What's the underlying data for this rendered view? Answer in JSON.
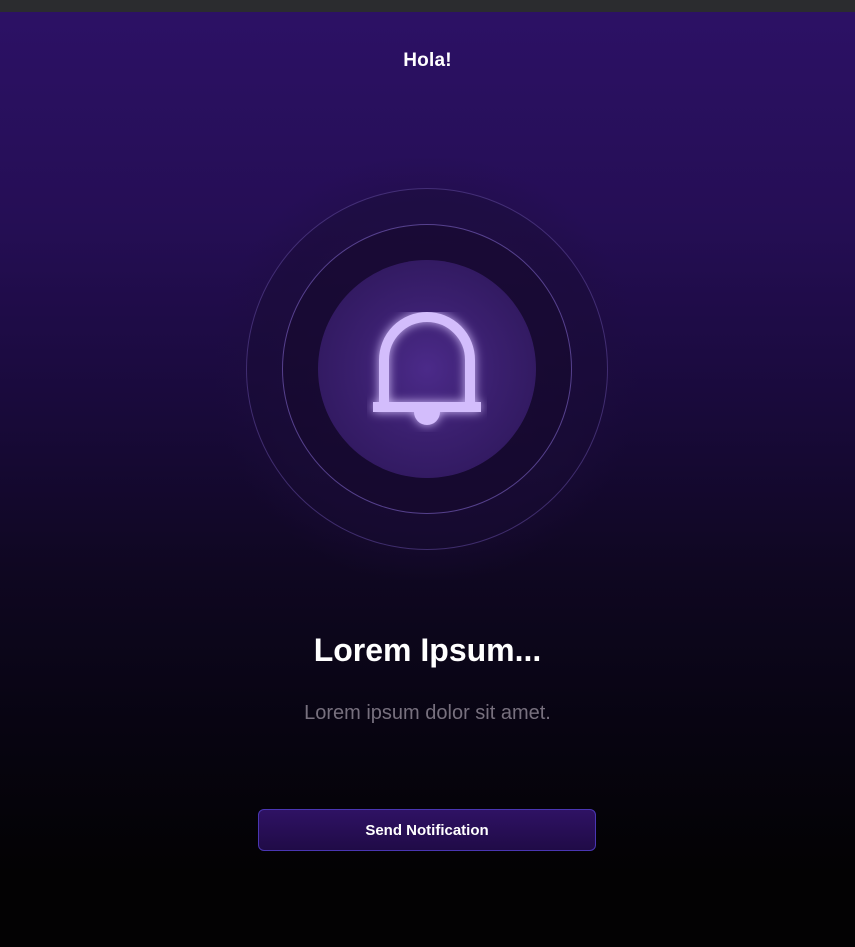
{
  "greeting": "Hola!",
  "hero": {
    "icon": "bell-icon"
  },
  "headline": "Lorem Ipsum...",
  "description": "Lorem ipsum dolor sit amet.",
  "actions": {
    "send_label": "Send Notification"
  },
  "colors": {
    "accent": "#d3bdfc",
    "background_top": "#2c1165",
    "background_bottom": "#030203",
    "button_border": "#4a36b2",
    "subtitle": "#77707e"
  }
}
